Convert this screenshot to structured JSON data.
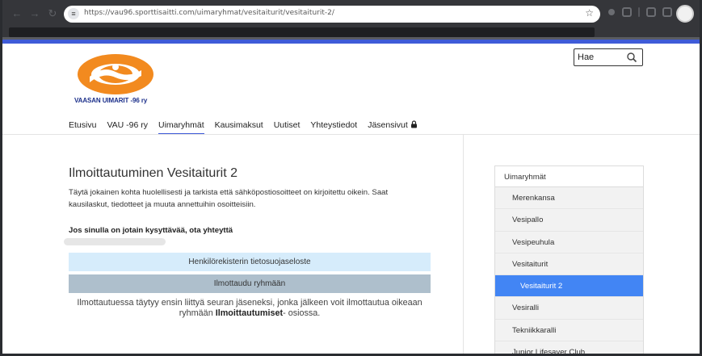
{
  "browser": {
    "url": "https://vau96.sporttisaitti.com/uimaryhmat/vesitaiturit/vesitaiturit-2/"
  },
  "header": {
    "search_placeholder": "Hae",
    "logo_text": "VAASAN UIMARIT -96 ry"
  },
  "nav": {
    "items": [
      "Etusivu",
      "VAU -96 ry",
      "Uimaryhmät",
      "Kausimaksut",
      "Uutiset",
      "Yhteystiedot",
      "Jäsensivut"
    ],
    "active": "Uimaryhmät"
  },
  "main": {
    "title": "Ilmoittautuminen Vesitaiturit 2",
    "lead": "Täytä jokainen kohta huolellisesti ja tarkista että sähköpostiosoitteet on kirjoitettu oikein. Saat kausilaskut, tiedotteet ja muuta annettuihin osoitteisiin.",
    "contact_heading": "Jos sinulla on jotain kysyttävää, ota yhteyttä",
    "privacy_button": "Henkilörekisterin tietosuojaseloste",
    "join_button": "Ilmottaudu ryhmään",
    "note_part1": "Ilmottautuessa täytyy ensin liittyä seuran jäseneksi, jonka jälkeen voit ilmottautua oikeaan ryhmään ",
    "note_bold": "Ilmoittautumiset",
    "note_part2": "- osiossa."
  },
  "sidebar": {
    "heading": "Uimaryhmät",
    "items": [
      "Merenkansa",
      "Vesipallo",
      "Vesipeuhula",
      "Vesitaiturit",
      "Vesitaiturit 2",
      "Vesiralli",
      "Tekniikkaralli",
      "Junior Lifesaver Club"
    ],
    "active": "Vesitaiturit 2"
  },
  "colors": {
    "accent": "#3f5bd8",
    "logo_orange": "#f28a1f",
    "logo_text": "#1b2f8a",
    "sidebar_active": "#4285f4",
    "privacy_button_bg": "#d6ecfb",
    "join_button_bg": "#aebfcc"
  }
}
